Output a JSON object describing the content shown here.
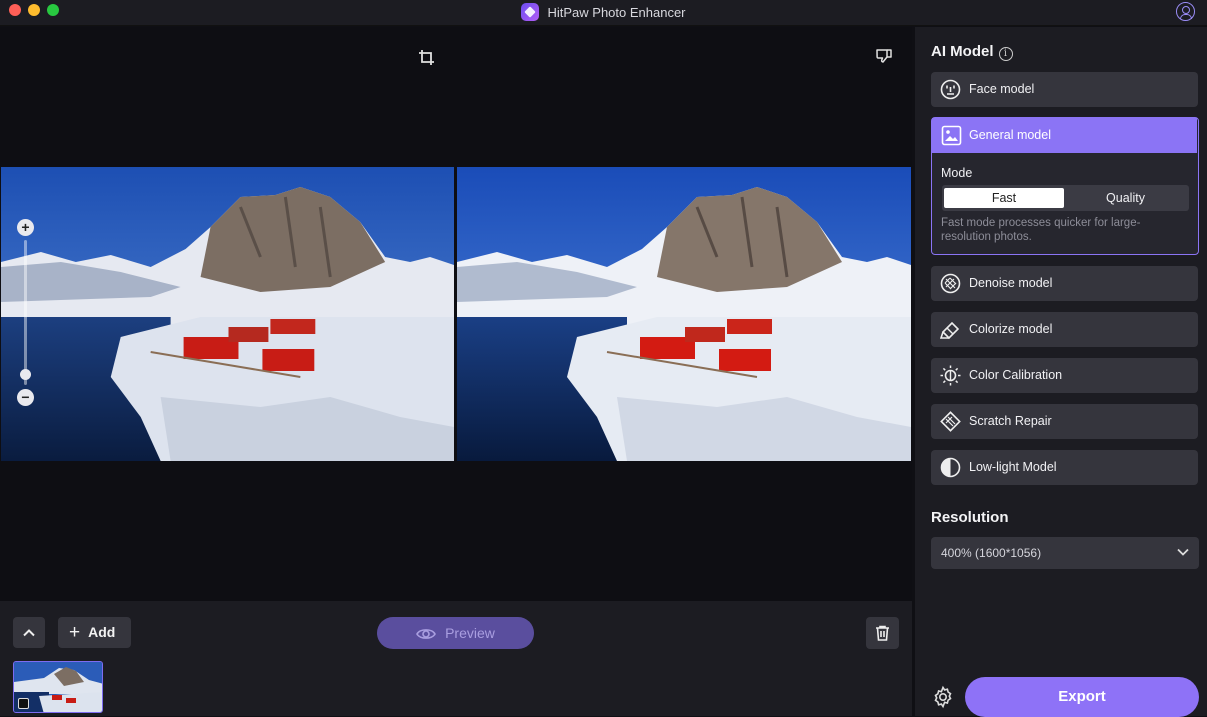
{
  "window": {
    "title": "HitPaw Photo Enhancer"
  },
  "bottom": {
    "add_label": "Add",
    "preview_label": "Preview"
  },
  "sidebar": {
    "ai_model_title": "AI Model",
    "models": [
      {
        "label": "Face model",
        "icon": "face-icon"
      },
      {
        "label": "General model",
        "icon": "image-icon",
        "selected": true
      },
      {
        "label": "Denoise model",
        "icon": "denoise-icon"
      },
      {
        "label": "Colorize model",
        "icon": "colorize-icon"
      },
      {
        "label": "Color Calibration",
        "icon": "brightness-icon"
      },
      {
        "label": "Scratch Repair",
        "icon": "scratch-icon"
      },
      {
        "label": "Low-light Model",
        "icon": "contrast-icon"
      }
    ],
    "mode": {
      "label": "Mode",
      "options": [
        "Fast",
        "Quality"
      ],
      "selected": "Fast",
      "description": "Fast mode processes quicker for large-resolution photos."
    },
    "resolution_title": "Resolution",
    "resolution_value": "400% (1600*1056)",
    "export_label": "Export"
  },
  "colors": {
    "accent": "#8b74f5",
    "background": "#0f0f14",
    "panel": "#1c1c22",
    "button": "#35353d"
  }
}
